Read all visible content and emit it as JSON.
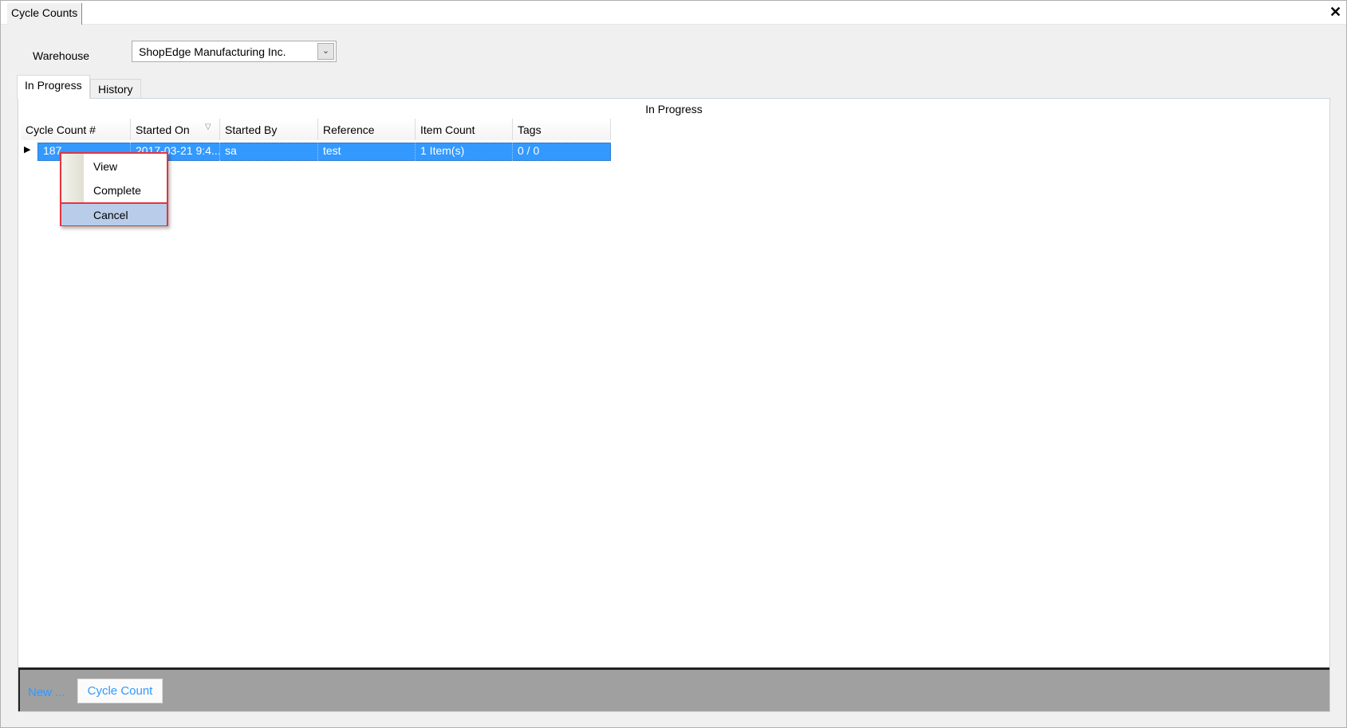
{
  "window": {
    "title": "Cycle Counts",
    "close_icon": "close-icon"
  },
  "warehouse": {
    "label": "Warehouse",
    "value": "ShopEdge Manufacturing Inc."
  },
  "tabs": [
    {
      "label": "In Progress",
      "active": true
    },
    {
      "label": "History",
      "active": false
    }
  ],
  "panel": {
    "caption": "In Progress"
  },
  "grid": {
    "columns": [
      "Cycle Count #",
      "Started On",
      "Started By",
      "Reference",
      "Item Count",
      "Tags"
    ],
    "sorted_column": "Started On",
    "rows": [
      {
        "cells": [
          "187",
          "2017-03-21  9:4...",
          "sa",
          "test",
          "1 Item(s)",
          "0 / 0"
        ],
        "selected": true
      }
    ]
  },
  "context_menu": {
    "items": [
      {
        "label": "View"
      },
      {
        "label": "Complete"
      },
      {
        "label": "Cancel",
        "highlighted": true
      }
    ]
  },
  "bottombar": {
    "new_label": "New ...",
    "cycle_count_button": "Cycle Count"
  },
  "colors": {
    "selection": "#3399ff",
    "highlight_box": "#e5343c",
    "link": "#3399ff"
  }
}
